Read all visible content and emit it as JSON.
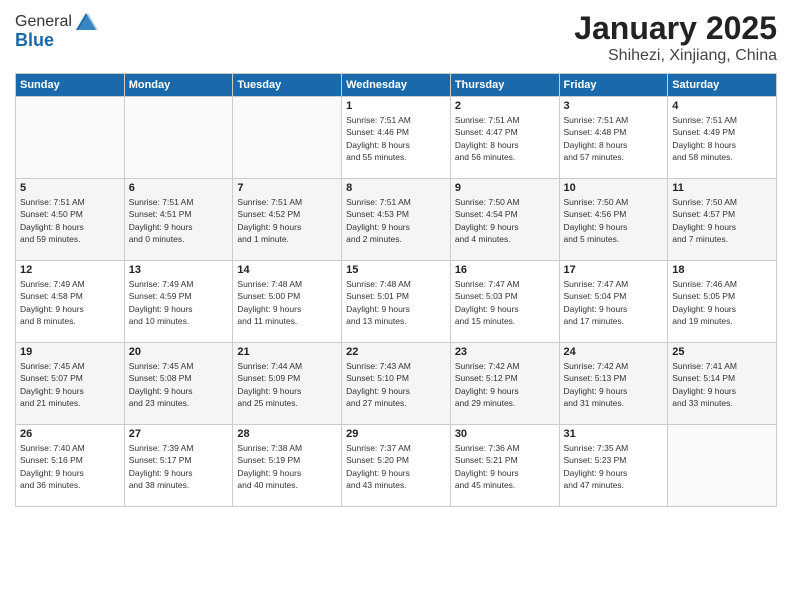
{
  "logo": {
    "general": "General",
    "blue": "Blue"
  },
  "title": {
    "month": "January 2025",
    "location": "Shihezi, Xinjiang, China"
  },
  "headers": [
    "Sunday",
    "Monday",
    "Tuesday",
    "Wednesday",
    "Thursday",
    "Friday",
    "Saturday"
  ],
  "weeks": [
    [
      {
        "day": "",
        "info": ""
      },
      {
        "day": "",
        "info": ""
      },
      {
        "day": "",
        "info": ""
      },
      {
        "day": "1",
        "info": "Sunrise: 7:51 AM\nSunset: 4:46 PM\nDaylight: 8 hours\nand 55 minutes."
      },
      {
        "day": "2",
        "info": "Sunrise: 7:51 AM\nSunset: 4:47 PM\nDaylight: 8 hours\nand 56 minutes."
      },
      {
        "day": "3",
        "info": "Sunrise: 7:51 AM\nSunset: 4:48 PM\nDaylight: 8 hours\nand 57 minutes."
      },
      {
        "day": "4",
        "info": "Sunrise: 7:51 AM\nSunset: 4:49 PM\nDaylight: 8 hours\nand 58 minutes."
      }
    ],
    [
      {
        "day": "5",
        "info": "Sunrise: 7:51 AM\nSunset: 4:50 PM\nDaylight: 8 hours\nand 59 minutes."
      },
      {
        "day": "6",
        "info": "Sunrise: 7:51 AM\nSunset: 4:51 PM\nDaylight: 9 hours\nand 0 minutes."
      },
      {
        "day": "7",
        "info": "Sunrise: 7:51 AM\nSunset: 4:52 PM\nDaylight: 9 hours\nand 1 minute."
      },
      {
        "day": "8",
        "info": "Sunrise: 7:51 AM\nSunset: 4:53 PM\nDaylight: 9 hours\nand 2 minutes."
      },
      {
        "day": "9",
        "info": "Sunrise: 7:50 AM\nSunset: 4:54 PM\nDaylight: 9 hours\nand 4 minutes."
      },
      {
        "day": "10",
        "info": "Sunrise: 7:50 AM\nSunset: 4:56 PM\nDaylight: 9 hours\nand 5 minutes."
      },
      {
        "day": "11",
        "info": "Sunrise: 7:50 AM\nSunset: 4:57 PM\nDaylight: 9 hours\nand 7 minutes."
      }
    ],
    [
      {
        "day": "12",
        "info": "Sunrise: 7:49 AM\nSunset: 4:58 PM\nDaylight: 9 hours\nand 8 minutes."
      },
      {
        "day": "13",
        "info": "Sunrise: 7:49 AM\nSunset: 4:59 PM\nDaylight: 9 hours\nand 10 minutes."
      },
      {
        "day": "14",
        "info": "Sunrise: 7:48 AM\nSunset: 5:00 PM\nDaylight: 9 hours\nand 11 minutes."
      },
      {
        "day": "15",
        "info": "Sunrise: 7:48 AM\nSunset: 5:01 PM\nDaylight: 9 hours\nand 13 minutes."
      },
      {
        "day": "16",
        "info": "Sunrise: 7:47 AM\nSunset: 5:03 PM\nDaylight: 9 hours\nand 15 minutes."
      },
      {
        "day": "17",
        "info": "Sunrise: 7:47 AM\nSunset: 5:04 PM\nDaylight: 9 hours\nand 17 minutes."
      },
      {
        "day": "18",
        "info": "Sunrise: 7:46 AM\nSunset: 5:05 PM\nDaylight: 9 hours\nand 19 minutes."
      }
    ],
    [
      {
        "day": "19",
        "info": "Sunrise: 7:45 AM\nSunset: 5:07 PM\nDaylight: 9 hours\nand 21 minutes."
      },
      {
        "day": "20",
        "info": "Sunrise: 7:45 AM\nSunset: 5:08 PM\nDaylight: 9 hours\nand 23 minutes."
      },
      {
        "day": "21",
        "info": "Sunrise: 7:44 AM\nSunset: 5:09 PM\nDaylight: 9 hours\nand 25 minutes."
      },
      {
        "day": "22",
        "info": "Sunrise: 7:43 AM\nSunset: 5:10 PM\nDaylight: 9 hours\nand 27 minutes."
      },
      {
        "day": "23",
        "info": "Sunrise: 7:42 AM\nSunset: 5:12 PM\nDaylight: 9 hours\nand 29 minutes."
      },
      {
        "day": "24",
        "info": "Sunrise: 7:42 AM\nSunset: 5:13 PM\nDaylight: 9 hours\nand 31 minutes."
      },
      {
        "day": "25",
        "info": "Sunrise: 7:41 AM\nSunset: 5:14 PM\nDaylight: 9 hours\nand 33 minutes."
      }
    ],
    [
      {
        "day": "26",
        "info": "Sunrise: 7:40 AM\nSunset: 5:16 PM\nDaylight: 9 hours\nand 36 minutes."
      },
      {
        "day": "27",
        "info": "Sunrise: 7:39 AM\nSunset: 5:17 PM\nDaylight: 9 hours\nand 38 minutes."
      },
      {
        "day": "28",
        "info": "Sunrise: 7:38 AM\nSunset: 5:19 PM\nDaylight: 9 hours\nand 40 minutes."
      },
      {
        "day": "29",
        "info": "Sunrise: 7:37 AM\nSunset: 5:20 PM\nDaylight: 9 hours\nand 43 minutes."
      },
      {
        "day": "30",
        "info": "Sunrise: 7:36 AM\nSunset: 5:21 PM\nDaylight: 9 hours\nand 45 minutes."
      },
      {
        "day": "31",
        "info": "Sunrise: 7:35 AM\nSunset: 5:23 PM\nDaylight: 9 hours\nand 47 minutes."
      },
      {
        "day": "",
        "info": ""
      }
    ]
  ]
}
